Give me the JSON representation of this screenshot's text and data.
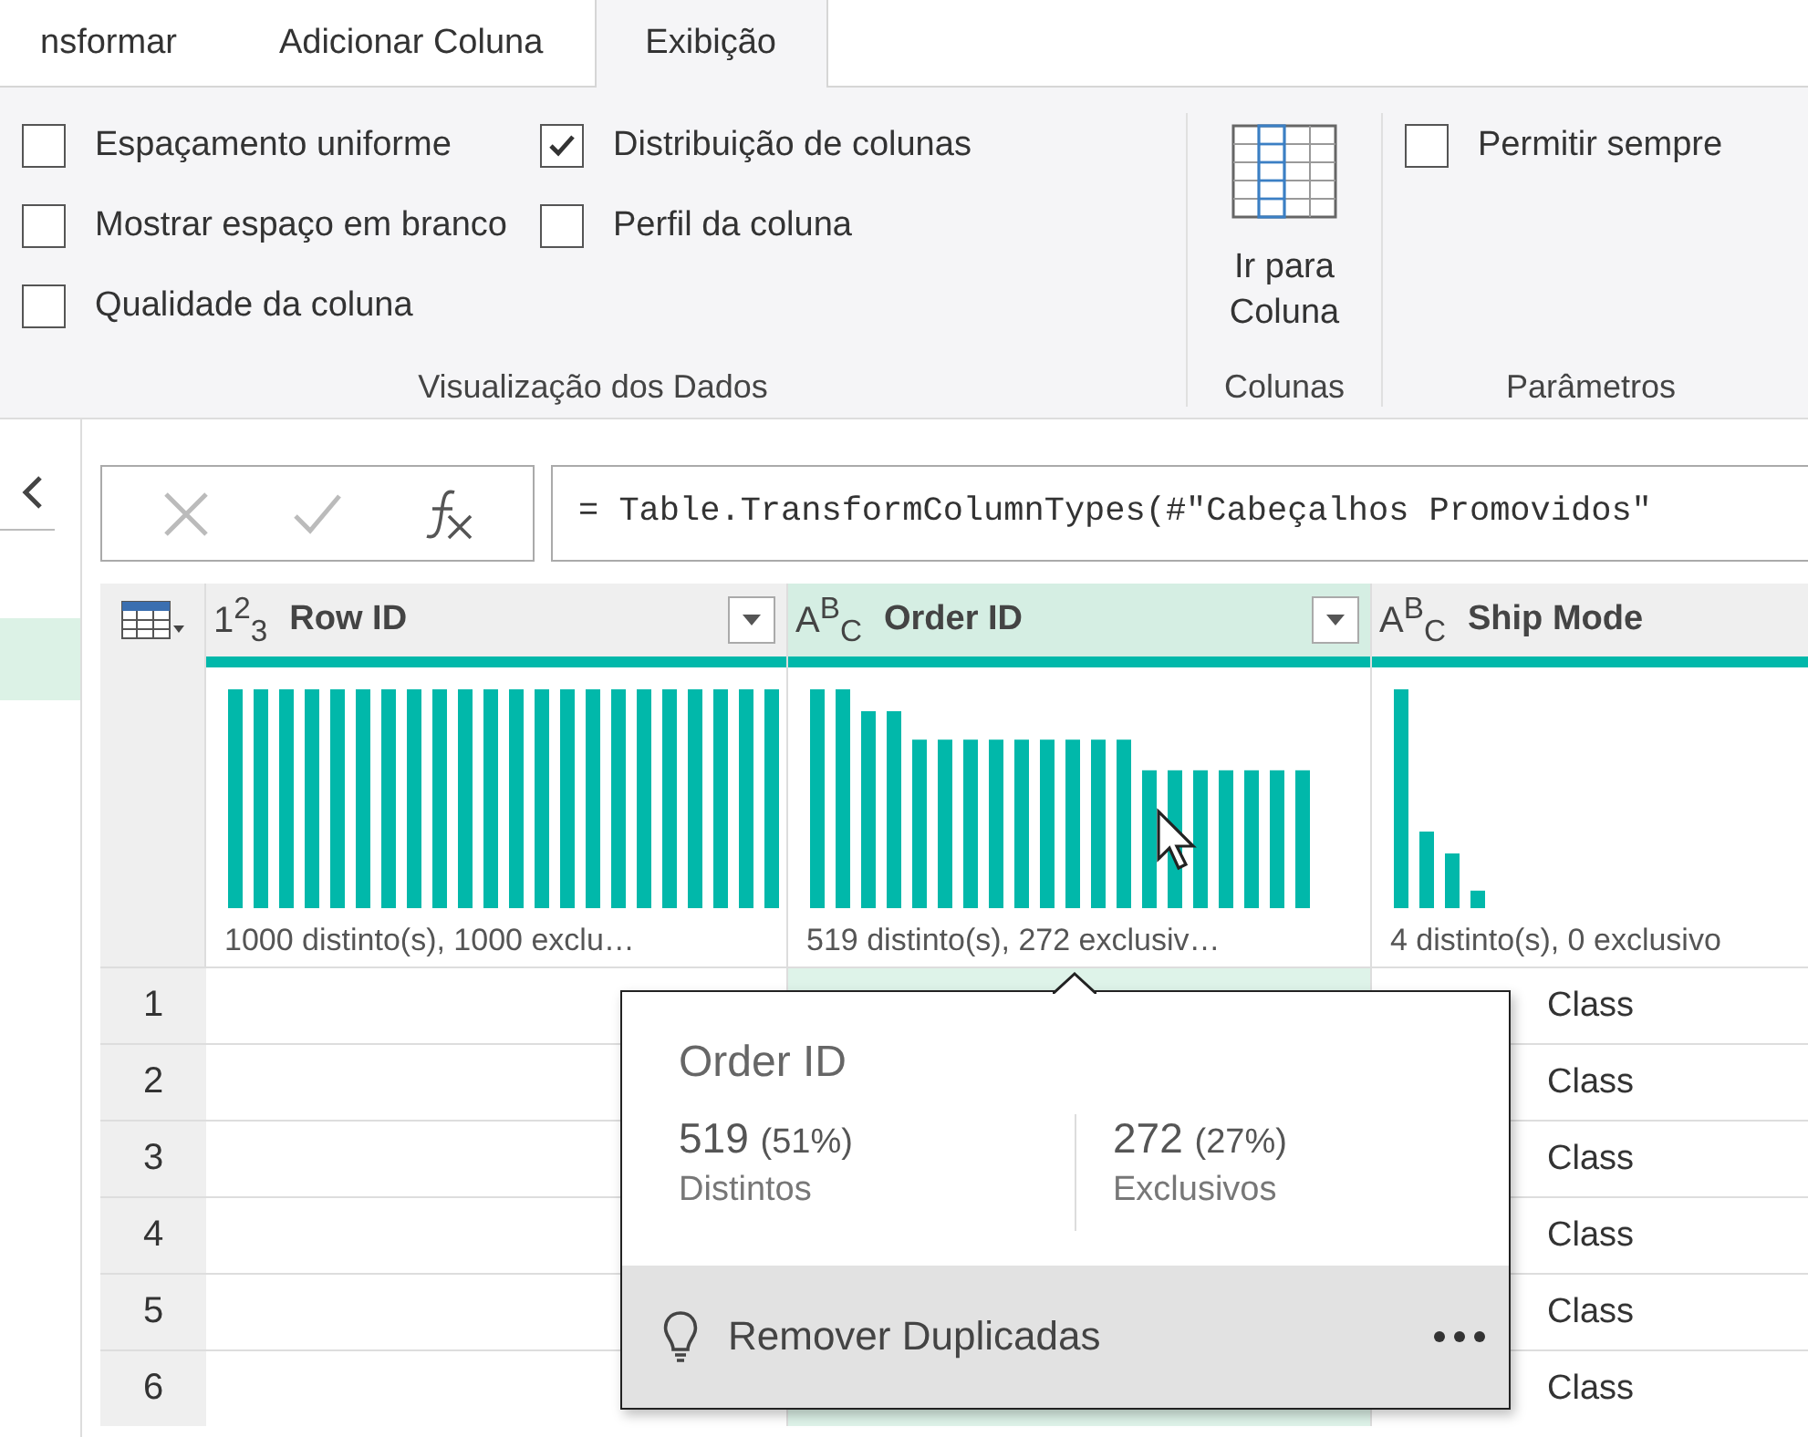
{
  "tabs": [
    {
      "label": "nsformar",
      "selected": false
    },
    {
      "label": "Adicionar Coluna",
      "selected": false
    },
    {
      "label": "Exibição",
      "selected": true
    }
  ],
  "ribbon": {
    "groups": [
      {
        "kind": "checkboxes",
        "label": "Visualização dos Dados",
        "columns": [
          [
            {
              "label": "Espaçamento uniforme",
              "checked": false
            },
            {
              "label": "Mostrar espaço em branco",
              "checked": false
            },
            {
              "label": "Qualidade da coluna",
              "checked": false
            }
          ],
          [
            {
              "label": "Distribuição de colunas",
              "checked": true
            },
            {
              "label": "Perfil da coluna",
              "checked": false
            }
          ]
        ]
      },
      {
        "kind": "button",
        "label": "Colunas",
        "button": "Ir para Coluna"
      },
      {
        "kind": "checkboxes",
        "label": "Parâmetros",
        "columns": [
          [
            {
              "label": "Permitir sempre",
              "checked": false
            }
          ]
        ]
      }
    ]
  },
  "formula_bar": {
    "formula": "= Table.TransformColumnTypes(#\"Cabeçalhos Promovidos\""
  },
  "table": {
    "columns": [
      {
        "name": "Row ID",
        "type_label": "1$^{2}$$_{3}$",
        "selected": false,
        "profile": "1000 distinto(s), 1000 exclu…"
      },
      {
        "name": "Order ID",
        "type_label": "A$^{B}$$_{C}$",
        "selected": true,
        "profile": "519 distinto(s), 272 exclusiv…"
      },
      {
        "name": "Ship Mode",
        "type_label": "A$^{B}$$_{C}$",
        "selected": false,
        "profile": "4 distinto(s), 0 exclusivo"
      }
    ],
    "rows": [
      {
        "number": "1",
        "ship_mode": "Class"
      },
      {
        "number": "2",
        "ship_mode": "Class"
      },
      {
        "number": "3",
        "ship_mode": "Class"
      },
      {
        "number": "4",
        "ship_mode": "Class"
      },
      {
        "number": "5",
        "ship_mode": "Class"
      },
      {
        "number": "6",
        "ship_mode": "Class"
      }
    ]
  },
  "tooltip": {
    "title": "Order ID",
    "stats": [
      {
        "value": "519",
        "percent": "(51%)",
        "label": "Distintos"
      },
      {
        "value": "272",
        "percent": "(27%)",
        "label": "Exclusivos"
      }
    ],
    "action": "Remover Duplicadas"
  }
}
